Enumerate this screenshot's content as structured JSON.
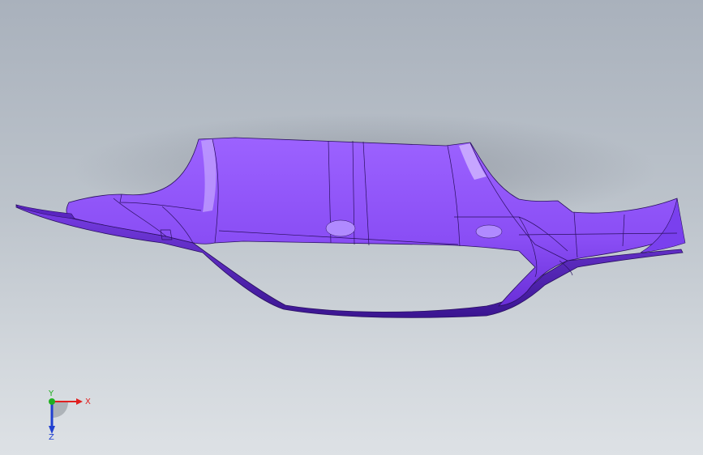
{
  "window": {
    "title": ""
  },
  "model": {
    "part_name": "bumper-cover",
    "body_color": "#8a4ef5",
    "highlight_color": "#a67bff",
    "shadow_color": "#4a1fa8",
    "edge_color": "#2a1060"
  },
  "triad": {
    "x_label": "X",
    "y_label": "Y",
    "z_label": "Z",
    "x_color": "#e02020",
    "y_color": "#20b020",
    "z_color": "#2040d0"
  },
  "colors": {
    "background_top": "#a9b1bc",
    "background_bottom": "#dde1e5"
  }
}
